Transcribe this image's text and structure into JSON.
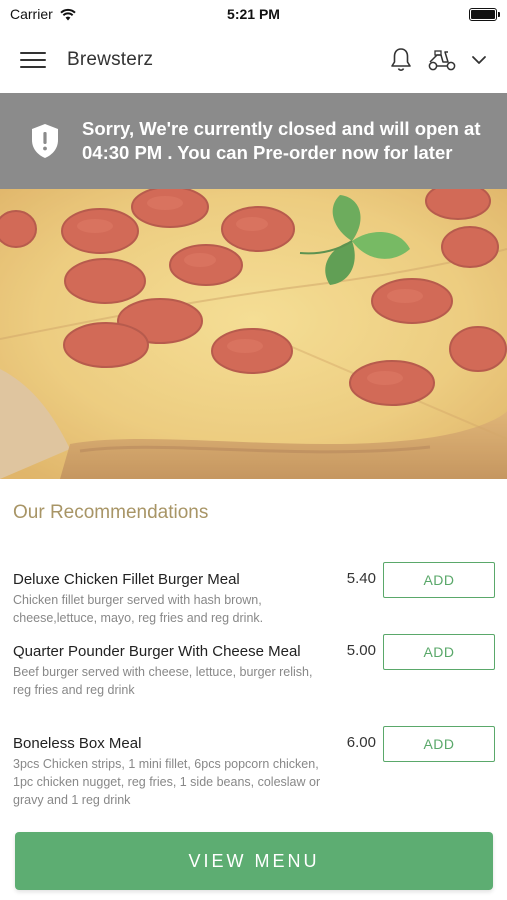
{
  "status_bar": {
    "carrier": "Carrier",
    "time": "5:21 PM"
  },
  "header": {
    "title": "Brewsterz",
    "icons": [
      "hamburger-menu-icon",
      "bell-icon",
      "scooter-icon",
      "chevron-down-icon"
    ]
  },
  "banner": {
    "text": "Sorry, We're currently closed and will open at 04:30 PM . You can Pre-order now for later",
    "icon": "shield-alert-icon",
    "background": "#8b8b8b"
  },
  "hero": {
    "image": "pepperoni-pizza"
  },
  "recommendations": {
    "title": "Our Recommendations",
    "items": [
      {
        "name": "Deluxe Chicken Fillet Burger Meal",
        "description": "Chicken fillet burger served with hash brown, cheese,lettuce, mayo, reg fries and reg drink.",
        "price": "5.40",
        "button": "ADD"
      },
      {
        "name": "Quarter Pounder Burger With Cheese Meal",
        "description": "Beef burger served with cheese, lettuce, burger relish, reg fries and reg drink",
        "price": "5.00",
        "button": "ADD"
      },
      {
        "name": "Boneless Box Meal",
        "description": "3pcs Chicken strips, 1 mini fillet, 6pcs popcorn chicken, 1pc chicken nugget, reg fries, 1 side beans, coleslaw or gravy and 1 reg drink",
        "price": "6.00",
        "button": "ADD"
      }
    ]
  },
  "footer": {
    "view_menu_label": "VIEW MENU"
  },
  "colors": {
    "accent_green": "#5dad72",
    "recommendation_title": "#a89566"
  }
}
